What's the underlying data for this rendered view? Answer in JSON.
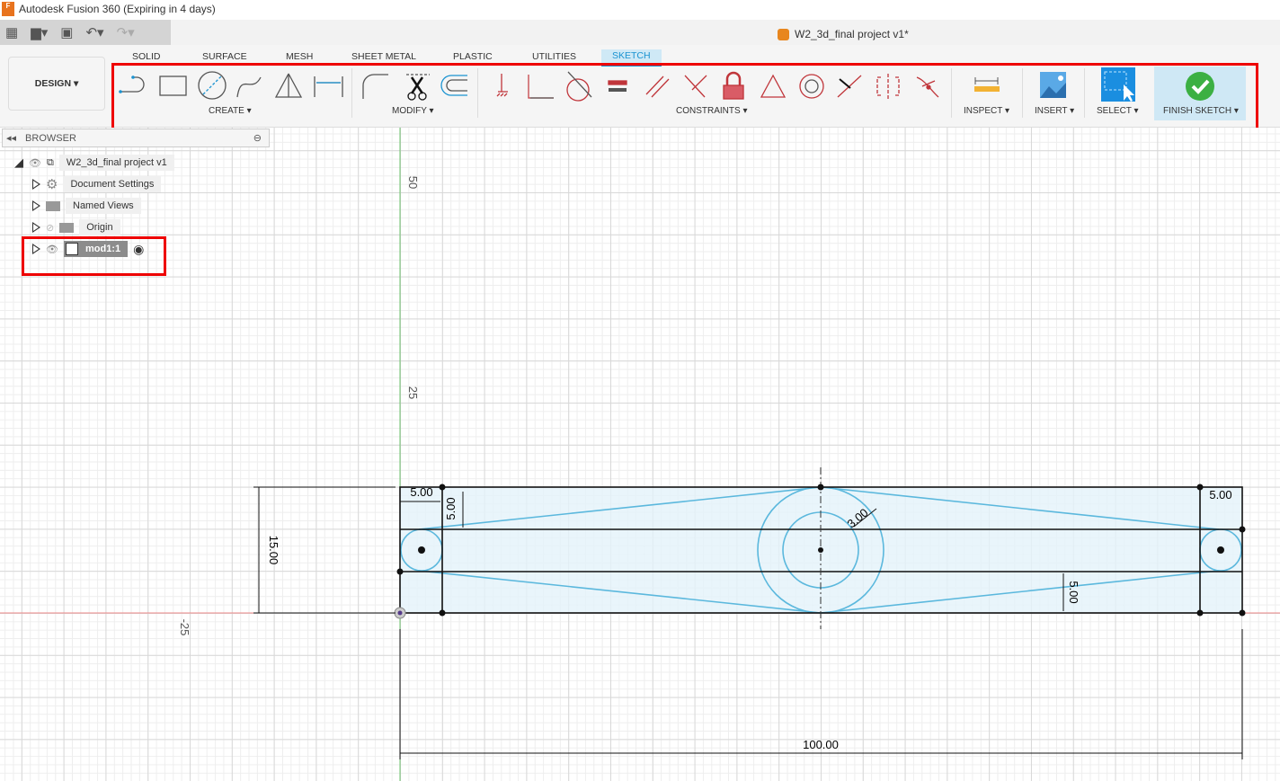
{
  "app": {
    "title": "Autodesk Fusion 360 (Expiring in 4 days)",
    "document_title": "W2_3d_final project v1*"
  },
  "quick_access": {
    "icons": [
      "grid-icon",
      "file-icon",
      "save-icon",
      "undo-icon",
      "redo-icon"
    ]
  },
  "workspace": {
    "label": "DESIGN"
  },
  "tabs": [
    {
      "label": "SOLID"
    },
    {
      "label": "SURFACE"
    },
    {
      "label": "MESH"
    },
    {
      "label": "SHEET METAL"
    },
    {
      "label": "PLASTIC"
    },
    {
      "label": "UTILITIES"
    },
    {
      "label": "SKETCH",
      "active": true
    }
  ],
  "toolbar": {
    "create": {
      "label": "CREATE",
      "tools": [
        "line",
        "rectangle",
        "circle",
        "spline",
        "mirror",
        "dimension"
      ]
    },
    "modify": {
      "label": "MODIFY",
      "tools": [
        "fillet",
        "trim",
        "offset"
      ]
    },
    "constraints": {
      "label": "CONSTRAINTS",
      "tools": [
        "horizontal-vertical",
        "coincident",
        "tangent",
        "equal",
        "parallel",
        "perpendicular",
        "fix",
        "midpoint",
        "concentric",
        "collinear",
        "symmetry",
        "curvature"
      ]
    },
    "inspect": {
      "label": "INSPECT"
    },
    "insert": {
      "label": "INSERT"
    },
    "select": {
      "label": "SELECT"
    },
    "finish": {
      "label": "FINISH SKETCH"
    }
  },
  "browser": {
    "title": "BROWSER",
    "items": [
      {
        "label": "W2_3d_final project v1"
      },
      {
        "label": "Document Settings"
      },
      {
        "label": "Named Views"
      },
      {
        "label": "Origin"
      },
      {
        "label": "mod1:1",
        "selected": true
      }
    ]
  },
  "sketch": {
    "axis_labels": {
      "y50": "50",
      "y25": "25",
      "xneg25": "-25"
    },
    "dimensions": {
      "left_width": "5.00",
      "left_height": "5.00",
      "right_width": "5.00",
      "right_height": "5.00",
      "radius": "3.00",
      "overall_height": "15.00",
      "overall_width": "100.00"
    }
  },
  "colors": {
    "accent": "#1a93d1",
    "highlight": "#e00000",
    "sketch_curve": "#5bb8dd",
    "profile_fill": "#e3f2fa",
    "finish_green": "#3cb043"
  }
}
